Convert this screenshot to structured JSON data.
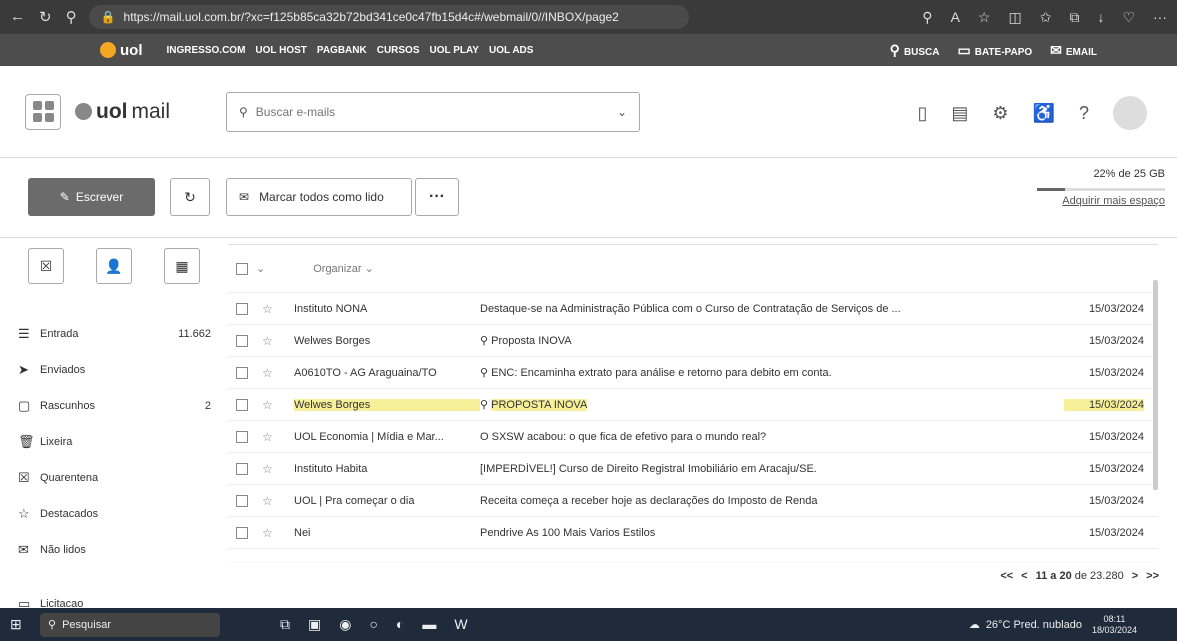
{
  "browser": {
    "url": "https://mail.uol.com.br/?xc=f125b85ca32b72bd341ce0c47fb15d4c#/webmail/0//INBOX/page2"
  },
  "uol_bar": {
    "logo": "uol",
    "links": [
      "INGRESSO.COM",
      "UOL HOST",
      "PAGBANK",
      "CURSOS",
      "UOL PLAY",
      "UOL ADS"
    ],
    "right": [
      "BUSCA",
      "BATE-PAPO",
      "EMAIL"
    ]
  },
  "header": {
    "logo_bold": "uol",
    "logo_text": " mail",
    "search_placeholder": "Buscar e-mails"
  },
  "toolbar": {
    "compose": "Escrever",
    "mark_all_read": "Marcar todos como lido",
    "more": "···",
    "storage_text": "22% de 25 GB",
    "storage_fraction": 0.22,
    "more_space": "Adquirir mais espaço"
  },
  "sidebar": {
    "folders": [
      {
        "label": "Entrada",
        "count": "11.662",
        "icon": "inbox-icon"
      },
      {
        "label": "Enviados",
        "count": "",
        "icon": "send-icon"
      },
      {
        "label": "Rascunhos",
        "count": "2",
        "icon": "draft-icon"
      },
      {
        "label": "Lixeira",
        "count": "",
        "icon": "trash-icon"
      },
      {
        "label": "Quarentena",
        "count": "",
        "icon": "quarantine-icon"
      },
      {
        "label": "Destacados",
        "count": "",
        "icon": "star-icon"
      },
      {
        "label": "Não lidos",
        "count": "",
        "icon": "unread-icon"
      }
    ],
    "extra_folder": "Licitacao"
  },
  "list": {
    "organize": "Organizar",
    "rows": [
      {
        "sender": "Instituto NONA",
        "subject": "Destaque-se na Administração Pública com o Curso de Contratação de Serviços de ...",
        "date": "15/03/2024",
        "attach": false
      },
      {
        "sender": "Welwes Borges",
        "subject": "Proposta INOVA",
        "date": "15/03/2024",
        "attach": true
      },
      {
        "sender": "A0610TO - AG Araguaina/TO",
        "subject": "ENC: Encaminha extrato para análise e retorno para debito em conta.",
        "date": "15/03/2024",
        "attach": true
      },
      {
        "sender": "Welwes Borges",
        "subject": "PROPOSTA INOVA",
        "date": "15/03/2024",
        "attach": true
      },
      {
        "sender": "UOL Economia | Mídia e Mar...",
        "subject": "O SXSW acabou: o que fica de efetivo para o mundo real?",
        "date": "15/03/2024",
        "attach": false
      },
      {
        "sender": "Instituto Habita",
        "subject": "[IMPERDÍVEL!] Curso de Direito Registral Imobiliário em Aracaju/SE.",
        "date": "15/03/2024",
        "attach": false
      },
      {
        "sender": "UOL | Pra começar o dia",
        "subject": "Receita começa a receber hoje as declarações do Imposto de Renda",
        "date": "15/03/2024",
        "attach": false
      },
      {
        "sender": "Nei",
        "subject": "Pendrive As 100 Mais Varios Estilos",
        "date": "15/03/2024",
        "attach": false
      }
    ],
    "pagination": {
      "range_prefix": "11 a 20",
      "range_suffix": " de 23.280"
    }
  },
  "taskbar": {
    "search": "Pesquisar",
    "weather": "26°C Pred. nublado",
    "time": "08:11",
    "date": "18/03/2024"
  }
}
